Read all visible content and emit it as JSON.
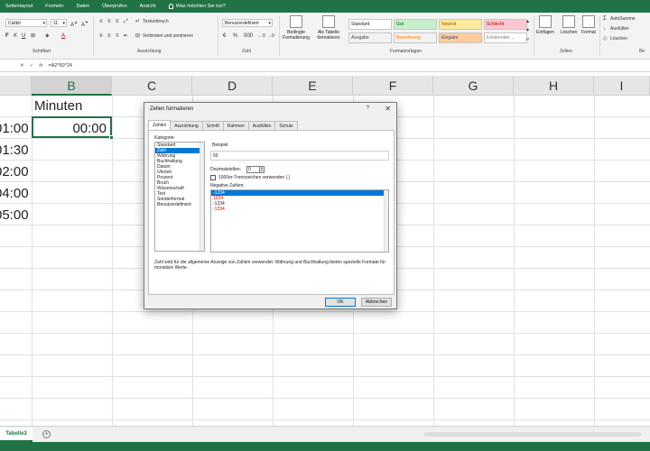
{
  "menu": {
    "items": [
      "Seitenlayout",
      "Formeln",
      "Daten",
      "Überprüfen",
      "Ansicht"
    ],
    "tell_me": "Was möchten Sie tun?"
  },
  "ribbon": {
    "font_name": "Calibri",
    "font_size": "11",
    "wrap_text": "Textumbruch",
    "merge_center": "Verbinden und zentrieren",
    "number_format": "Benutzerdefiniert",
    "cond_format": "Bedingte Formatierung",
    "as_table": "Als Tabelle formatieren",
    "insert": "Einfügen",
    "delete": "Löschen",
    "format": "Format",
    "autosum": "AutoSumme",
    "fill": "Ausfüllen",
    "clear": "Löschen",
    "groups": {
      "font": "Schriftart",
      "alignment": "Ausrichtung",
      "number": "Zahl",
      "styles": "Formatvorlagen",
      "cells": "Zellen",
      "editing": "Be"
    },
    "styles": [
      {
        "label": "Standard",
        "bg": "#ffffff",
        "fg": "#222222"
      },
      {
        "label": "Gut",
        "bg": "#c6efce",
        "fg": "#006100"
      },
      {
        "label": "Neutral",
        "bg": "#ffeb9c",
        "fg": "#9c5700"
      },
      {
        "label": "Schlecht",
        "bg": "#ffc7ce",
        "fg": "#9c0006"
      },
      {
        "label": "Ausgabe",
        "bg": "#f2f2f2",
        "fg": "#3f3f3f"
      },
      {
        "label": "Berechnung",
        "bg": "#f2f2f2",
        "fg": "#fa7d00"
      },
      {
        "label": "Eingabe",
        "bg": "#ffcc99",
        "fg": "#3f3f76"
      },
      {
        "label": "Erklärender ...",
        "bg": "#ffffff",
        "fg": "#7f7f7f"
      }
    ]
  },
  "formula_bar": {
    "fx": "fx",
    "formula": "=A2*60*24"
  },
  "grid": {
    "columns": [
      "B",
      "C",
      "D",
      "E",
      "F",
      "G",
      "H",
      "I"
    ],
    "header_cell": "Minuten",
    "col_a_values": [
      "01:00",
      "01:30",
      "02:00",
      "04:00",
      "05:00"
    ],
    "selected_value": "00:00"
  },
  "sheet_tabs": {
    "active": "Tabelle3",
    "add": "+"
  },
  "dialog": {
    "title": "Zellen formatieren",
    "help": "?",
    "close": "✕",
    "tabs": [
      "Zahlen",
      "Ausrichtung",
      "Schrift",
      "Rahmen",
      "Ausfüllen",
      "Schutz"
    ],
    "category_label": "Kategorie:",
    "categories": [
      "Standard",
      "Zahl",
      "Währung",
      "Buchhaltung",
      "Datum",
      "Uhrzeit",
      "Prozent",
      "Bruch",
      "Wissenschaft",
      "Text",
      "Sonderformat",
      "Benutzerdefiniert"
    ],
    "selected_category": "Zahl",
    "sample_label": "Beispiel",
    "sample_value": "60",
    "decimals_label": "Dezimalstellen:",
    "decimals_value": "0",
    "thousands_label": "1000er-Trennzeichen verwenden (.)",
    "negative_label": "Negative Zahlen:",
    "negative_numbers": [
      "-1234",
      "1234",
      "-1234",
      "-1234"
    ],
    "description": "Zahl wird für die allgemeine Anzeige von Zahlen verwendet. Währung und Buchhaltung bieten spezielle Formate für monetäre Werte.",
    "ok": "OK",
    "cancel": "Abbrechen"
  }
}
